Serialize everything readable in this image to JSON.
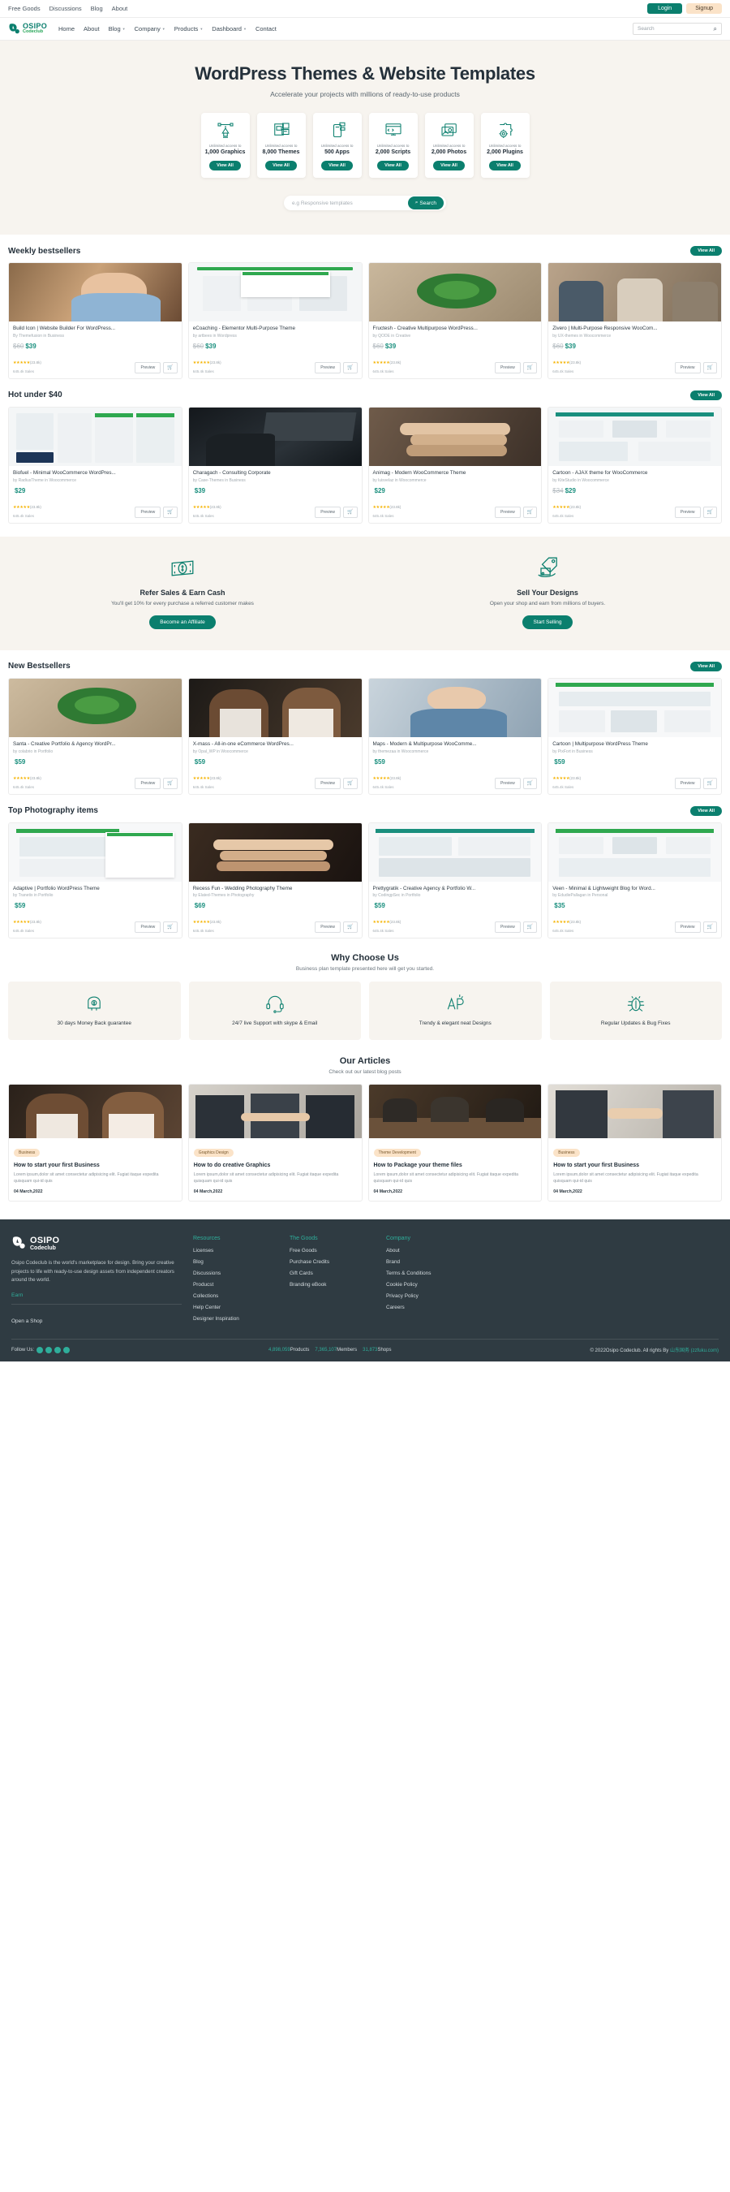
{
  "topbar": {
    "links": [
      "Free Goods",
      "Discussions",
      "Blog",
      "About"
    ],
    "login": "Login",
    "signup": "Signup"
  },
  "nav": {
    "logo_line1": "OSIPO",
    "logo_line2": "Codeclub",
    "items": [
      {
        "label": "Home",
        "caret": false
      },
      {
        "label": "About",
        "caret": false
      },
      {
        "label": "Blog",
        "caret": true
      },
      {
        "label": "Company",
        "caret": true
      },
      {
        "label": "Products",
        "caret": true
      },
      {
        "label": "Dashboard",
        "caret": true
      },
      {
        "label": "Contact",
        "caret": false
      }
    ],
    "search_placeholder": "Search",
    "search_icon": "search-icon"
  },
  "hero": {
    "title": "WordPress Themes & Website Templates",
    "subtitle": "Accelerate your projects with millions of ready-to-use products",
    "categories": [
      {
        "sub": "Unlimited access to",
        "title": "1,000 Graphics",
        "button": "View All",
        "icon": "pen-tool-icon"
      },
      {
        "sub": "Unlimited access to",
        "title": "8,000 Themes",
        "button": "View All",
        "icon": "layout-icon"
      },
      {
        "sub": "Unlimited access to",
        "title": "500 Apps",
        "button": "View All",
        "icon": "mobile-app-icon"
      },
      {
        "sub": "Unlimited access to",
        "title": "2,000 Scripts",
        "button": "View All",
        "icon": "code-monitor-icon"
      },
      {
        "sub": "Unlimited access to",
        "title": "2,000 Photos",
        "button": "View All",
        "icon": "photo-stack-icon"
      },
      {
        "sub": "Unlimited access to",
        "title": "2,000 Plugins",
        "button": "View All",
        "icon": "puzzle-gear-icon"
      }
    ],
    "search_placeholder": "e.g Responsive templates",
    "search_button": "Search"
  },
  "sections": [
    {
      "title": "Weekly bestsellers",
      "view_all": "View All",
      "products": [
        {
          "name": "Build Icon | Website Builder For WordPress...",
          "author": "By Themefusion in Business",
          "old_price": "$60",
          "price": "$39",
          "rating": "★★★★★",
          "count": "(23.8k)",
          "sales": "645.4k Sales",
          "preview": "Preview",
          "thumb": "photo-woman-phone"
        },
        {
          "name": "eCoaching - Elementor Multi-Purpose Theme",
          "author": "by artbees in Wordpress",
          "old_price": "$60",
          "price": "$39",
          "rating": "★★★★★",
          "count": "(23.8k)",
          "sales": "645.4k Sales",
          "preview": "Preview",
          "thumb": "ui-mock-green"
        },
        {
          "name": "Fructesh - Creative Multipurpose WordPress...",
          "author": "by QODE in Creative",
          "old_price": "$60",
          "price": "$39",
          "rating": "★★★★★",
          "count": "(23.8k)",
          "sales": "645.4k Sales",
          "preview": "Preview",
          "thumb": "photo-hands-plant"
        },
        {
          "name": "Zivero | Multi-Purpose Responsive WooCom...",
          "author": "by UX-themes in Woocommerce",
          "old_price": "$60",
          "price": "$39",
          "rating": "★★★★★",
          "count": "(23.8k)",
          "sales": "645.4k Sales",
          "preview": "Preview",
          "thumb": "photo-meeting"
        }
      ]
    },
    {
      "title": "Hot under $40",
      "view_all": "View All",
      "products": [
        {
          "name": "Biofuel - Minimal WooCommerce WordPres...",
          "author": "by RadiusTheme in Woocommerce",
          "old_price": "",
          "price": "$29",
          "rating": "★★★★★",
          "count": "(23.8k)",
          "sales": "645.4k Sales",
          "preview": "Preview",
          "thumb": "ui-mock-blue"
        },
        {
          "name": "Charagach - Consulting Corporate",
          "author": "by Case-Themes in Business",
          "old_price": "",
          "price": "$39",
          "rating": "★★★★★",
          "count": "(23.8k)",
          "sales": "645.4k Sales",
          "preview": "Preview",
          "thumb": "photo-laptop-dark"
        },
        {
          "name": "Animag - Modern WooCommerce Theme",
          "author": "by luisvelaz in Woocommerce",
          "old_price": "",
          "price": "$29",
          "rating": "★★★★★",
          "count": "(23.8k)",
          "sales": "645.4k Sales",
          "preview": "Preview",
          "thumb": "photo-hands-stack"
        },
        {
          "name": "Cartoon - AJAX theme for WooCommerce",
          "author": "by KiteStudio in Woocommerce",
          "old_price": "$34",
          "price": "$29",
          "rating": "★★★★★",
          "count": "(23.8k)",
          "sales": "645.4k Sales",
          "preview": "Preview",
          "thumb": "ui-mock-teal"
        }
      ]
    }
  ],
  "promo": [
    {
      "icon": "cash-icon",
      "title": "Refer Sales & Earn Cash",
      "text": "You'll get 10% for every purchase a referred customer makes",
      "button": "Become an Affiliate"
    },
    {
      "icon": "sell-tag-icon",
      "title": "Sell Your Designs",
      "text": "Open your shop and earn from millions of buyers.",
      "button": "Start Selling"
    }
  ],
  "sections2": [
    {
      "title": "New Bestsellers",
      "view_all": "View All",
      "products": [
        {
          "name": "Santa - Creative Portfolio & Agency WordPr...",
          "author": "by colabrio in Portfolio",
          "old_price": "",
          "price": "$59",
          "rating": "★★★★★",
          "count": "(23.8k)",
          "sales": "645.4k Sales",
          "preview": "Preview",
          "thumb": "photo-hands-plant"
        },
        {
          "name": "X-mass - All-in-one eCommerce WordPres...",
          "author": "by Opal_WP in Woocommerce",
          "old_price": "",
          "price": "$59",
          "rating": "★★★★★",
          "count": "(23.8k)",
          "sales": "645.4k Sales",
          "preview": "Preview",
          "thumb": "photo-two-women"
        },
        {
          "name": "Maps - Modern & Multipurpose WooComme...",
          "author": "by themezaa in Woocommerce",
          "old_price": "",
          "price": "$59",
          "rating": "★★★★★",
          "count": "(23.8k)",
          "sales": "645.4k Sales",
          "preview": "Preview",
          "thumb": "photo-woman-blue"
        },
        {
          "name": "Cartoon | Multipurpose WordPress Theme",
          "author": "by PixFort in Business",
          "old_price": "",
          "price": "$59",
          "rating": "★★★★★",
          "count": "(23.8k)",
          "sales": "645.4k Sales",
          "preview": "Preview",
          "thumb": "ui-mock-green"
        }
      ]
    },
    {
      "title": "Top Photography items",
      "view_all": "View All",
      "products": [
        {
          "name": "Adaptive | Portfolio WordPress Theme",
          "author": "by Tranetix in Portfolio",
          "old_price": "",
          "price": "$59",
          "rating": "★★★★★",
          "count": "(23.8k)",
          "sales": "645.4k Sales",
          "preview": "Preview",
          "thumb": "ui-mock-green"
        },
        {
          "name": "Recess Fun - Wedding Photography Theme",
          "author": "by Elated-Themes in Photography",
          "old_price": "",
          "price": "$69",
          "rating": "★★★★★",
          "count": "(23.8k)",
          "sales": "645.4k Sales",
          "preview": "Preview",
          "thumb": "photo-hands-stack"
        },
        {
          "name": "Prettygratik - Creative Agency & Portfolio W...",
          "author": "by CodingpSec in Portfolio",
          "old_price": "",
          "price": "$59",
          "rating": "★★★★★",
          "count": "(23.8k)",
          "sales": "645.4k Sales",
          "preview": "Preview",
          "thumb": "ui-mock-teal"
        },
        {
          "name": "Veen - Minimal & Lightweight Blog for Word...",
          "author": "by EdudiePallagan in Personal",
          "old_price": "",
          "price": "$35",
          "rating": "★★★★★",
          "count": "(23.8k)",
          "sales": "645.4k Sales",
          "preview": "Preview",
          "thumb": "ui-mock-blue"
        }
      ]
    }
  ],
  "why": {
    "title": "Why Choose Us",
    "subtitle": "Business plan template presented here will get you started.",
    "cards": [
      {
        "icon": "money-back-icon",
        "text": "30 days Money Back guarantee"
      },
      {
        "icon": "support-icon",
        "text": "24/7 live Support with skype & Email"
      },
      {
        "icon": "design-icon",
        "text": "Trendy & elegant neat Designs"
      },
      {
        "icon": "bug-icon",
        "text": "Regular Updates & Bug Fixes"
      }
    ]
  },
  "articles": {
    "title": "Our Articles",
    "subtitle": "Check out our latest blog posts",
    "items": [
      {
        "tag": "Business",
        "title": "How to start your first Business",
        "excerpt": "Lorem ipsum,dolor sit amet consectetur adipisicing elit. Fugiat itaque expedita quisquam qui-id quis",
        "date": "04 March,2022",
        "thumb": "photo-two-women"
      },
      {
        "tag": "Graphics Design",
        "title": "How to do creative Graphics",
        "excerpt": "Lorem ipsum,dolor sit amet consectetur adipisicing elit. Fugiat itaque expedita quisquam qui-id quis",
        "date": "04 March,2022",
        "thumb": "photo-handshake"
      },
      {
        "tag": "Theme Development",
        "title": "How to Package your theme files",
        "excerpt": "Lorem ipsum,dolor sit amet consectetur adipisicing elit. Fugiat itaque expedita quisquam qui-id quis",
        "date": "04 March,2022",
        "thumb": "photo-meeting-table"
      },
      {
        "tag": "Business",
        "title": "How to start your first Business",
        "excerpt": "Lorem ipsum,dolor sit amet consectetur adipisicing elit. Fugiat itaque expedita quisquam qui-id quis",
        "date": "04 March,2022",
        "thumb": "photo-handshake2"
      }
    ]
  },
  "footer": {
    "logo_line1": "OSIPO",
    "logo_line2": "Codeclub",
    "description": "Osipo Codeclub is the world's marketplace for design. Bring your creative projects to life with ready-to-use design assets from independent creators around the world.",
    "earn": "Earn",
    "open_shop": "Open a Shop",
    "columns": [
      {
        "heading": "Resources",
        "links": [
          "Licenses",
          "Blog",
          "Discussions",
          "Producst",
          "Collections",
          "Help Center",
          "Designer Inspiration"
        ]
      },
      {
        "heading": "The Goods",
        "links": [
          "Free Goods",
          "Purchase Credits",
          "Gift Cards",
          "Branding eBook"
        ]
      },
      {
        "heading": "Company",
        "links": [
          "About",
          "Brand",
          "Terms & Conditions",
          "Cookie Policy",
          "Privacy Policy",
          "Careers"
        ]
      }
    ],
    "follow_label": "Follow Us:",
    "stats": [
      {
        "value": "4,898,059",
        "label": "Products"
      },
      {
        "value": "7,365,107",
        "label": "Members"
      },
      {
        "value": "31,873",
        "label": "Shops"
      }
    ],
    "copyright": "© 2022Osipo Codeclub. All rights By",
    "copyright_link": "山东国务",
    "copyright_link2": "(zzfuku.com)"
  },
  "colors": {
    "brand": "#0b7f6e",
    "accent_green": "#23a455",
    "hero_bg": "#f7f4ef",
    "footer_bg": "#2f3b42",
    "star": "#f5b301",
    "tag_bg": "#fbe3c8"
  }
}
